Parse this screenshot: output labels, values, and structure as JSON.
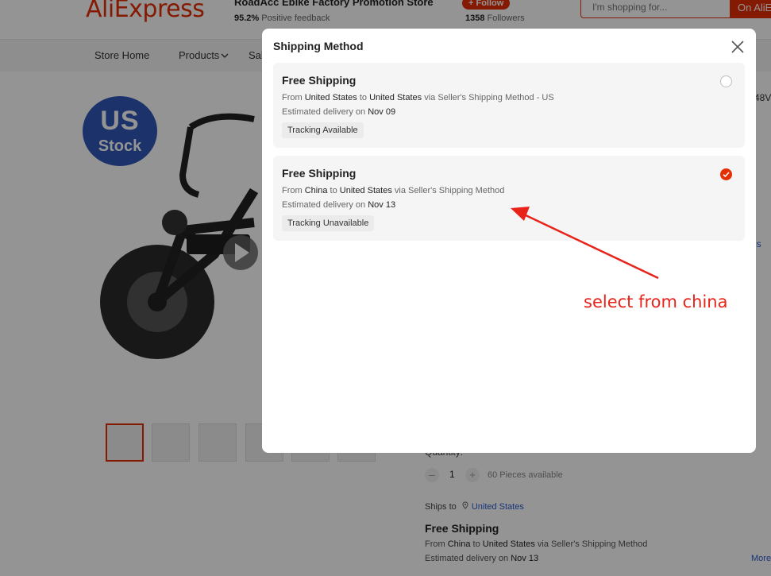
{
  "header": {
    "logo": "AliExpress",
    "store_name": "RoadAcc Ebike Factory Promotion Store",
    "feedback_pct": "95.2%",
    "feedback_label": "Positive feedback",
    "follow_label": "+ Follow",
    "followers_count": "1358",
    "followers_label": "Followers",
    "search_placeholder": "I'm shopping for...",
    "search_button": "On AliE"
  },
  "nav": {
    "items": [
      "Store Home",
      "Products",
      "Sal"
    ]
  },
  "product": {
    "badge_line1": "US",
    "badge_line2": "Stock",
    "right_edge_1": "48V",
    "right_edge_2": "ns"
  },
  "purchase": {
    "quantity_label": "Quantity:",
    "qty_minus": "–",
    "qty_value": "1",
    "qty_plus": "+",
    "pieces_available": "60 Pieces available",
    "ships_to_label": "Ships to",
    "ships_to_location": "United States",
    "shipping_title": "Free Shipping",
    "from_word": "From",
    "from_location": "China",
    "to_word": "to",
    "to_location": "United States",
    "via_text": "via Seller's Shipping Method",
    "est_label": "Estimated delivery on",
    "est_date": "Nov 13",
    "more_link": "More"
  },
  "modal": {
    "title": "Shipping Method",
    "options": [
      {
        "title": "Free Shipping",
        "from_word": "From",
        "from": "United States",
        "to_word": "to",
        "to": "United States",
        "via": "via Seller's Shipping Method - US",
        "est_label": "Estimated delivery on",
        "est_date": "Nov 09",
        "tag": "Tracking Available",
        "selected": false
      },
      {
        "title": "Free Shipping",
        "from_word": "From",
        "from": "China",
        "to_word": "to",
        "to": "United States",
        "via": "via Seller's Shipping Method",
        "est_label": "Estimated delivery on",
        "est_date": "Nov 13",
        "tag": "Tracking Unavailable",
        "selected": true
      }
    ]
  },
  "annotation": {
    "text": "select from china",
    "color": "#e8231a"
  },
  "colors": {
    "brand": "#e62e04",
    "link": "#2a5cd1",
    "badge": "#2f56b8"
  }
}
